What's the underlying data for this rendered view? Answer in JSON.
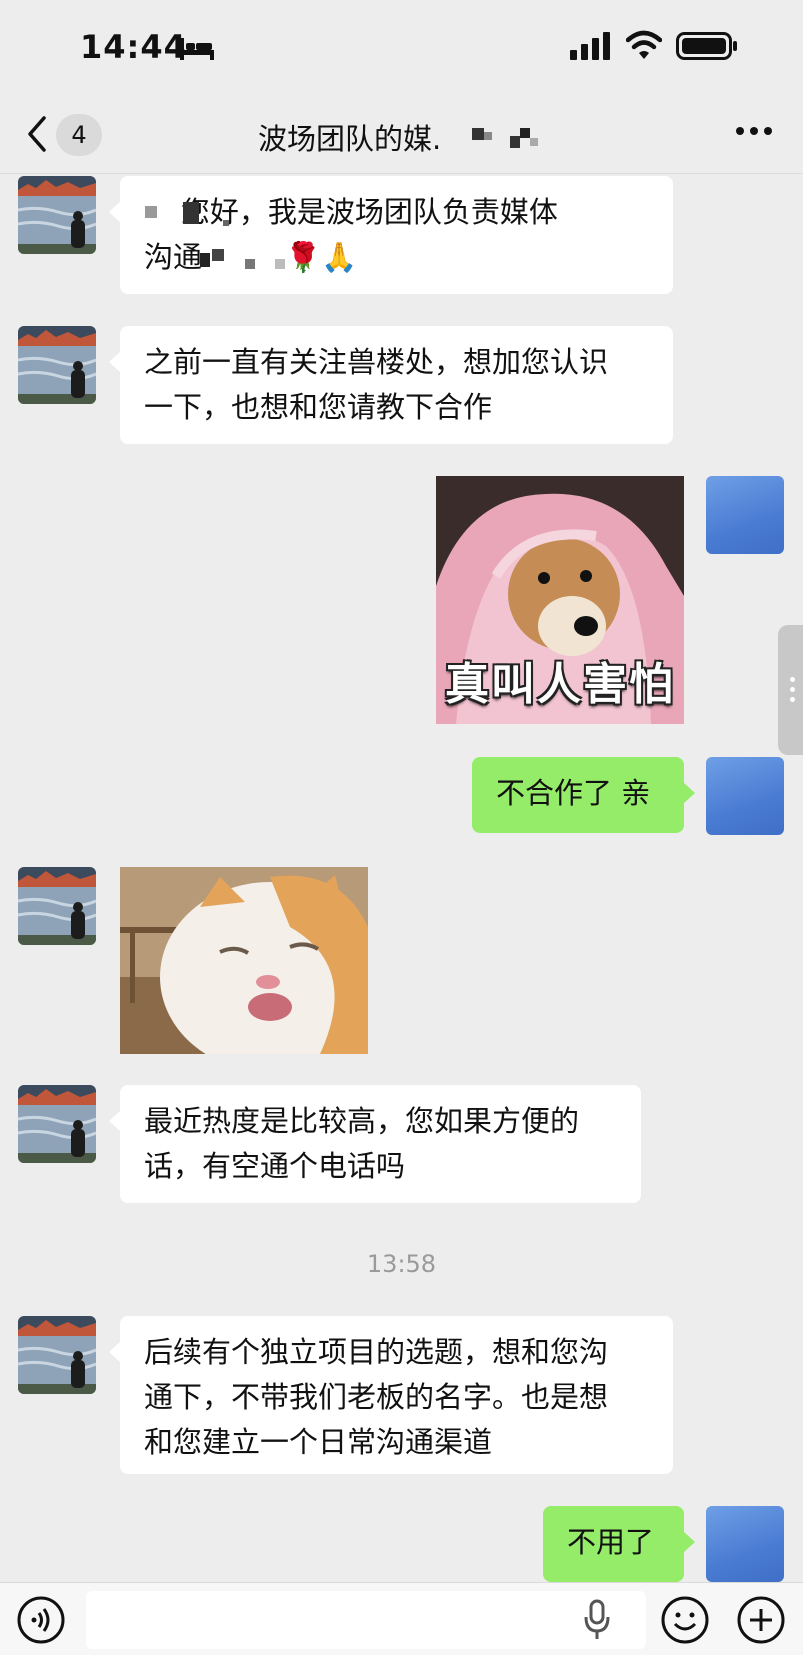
{
  "status_bar": {
    "time": "14:44",
    "icons": [
      "sleep-mode-icon",
      "cellular-signal-icon",
      "wifi-icon",
      "battery-icon"
    ]
  },
  "nav": {
    "back_icon": "chevron-left-icon",
    "unread_count": "4",
    "title": "波场团队的媒.",
    "more_icon": "more-dots-icon"
  },
  "messages": [
    {
      "from": "them",
      "type": "text",
      "text": "    您好，我是波场团队负责媒体\n沟通         🌹🙏"
    },
    {
      "from": "them",
      "type": "text",
      "text": "之前一直有关注兽楼处，想加您认识\n一下，也想和您请教下合作"
    },
    {
      "from": "me",
      "type": "sticker",
      "subject": "dog wrapped in pink blanket",
      "caption": "真叫人害怕"
    },
    {
      "from": "me",
      "type": "text",
      "text": "不合作了 亲"
    },
    {
      "from": "them",
      "type": "sticker",
      "subject": "squinting cat close-up"
    },
    {
      "from": "them",
      "type": "text",
      "text": "最近热度是比较高，您如果方便的\n话，有空通个电话吗"
    },
    {
      "from": "them",
      "type": "text",
      "text": "后续有个独立项目的选题，想和您沟\n通下，不带我们老板的名字。也是想\n和您建立一个日常沟通渠道"
    },
    {
      "from": "me",
      "type": "text",
      "text": "不用了"
    }
  ],
  "timestamp": "13:58",
  "input_bar": {
    "voice_icon": "voice-mode-icon",
    "placeholder": "",
    "mic_icon": "microphone-icon",
    "emoji_icon": "emoji-icon",
    "plus_icon": "add-icon"
  },
  "colors": {
    "background": "#ededed",
    "incoming_bubble": "#ffffff",
    "outgoing_bubble": "#95ec69",
    "self_avatar": "#4a7cd3"
  }
}
